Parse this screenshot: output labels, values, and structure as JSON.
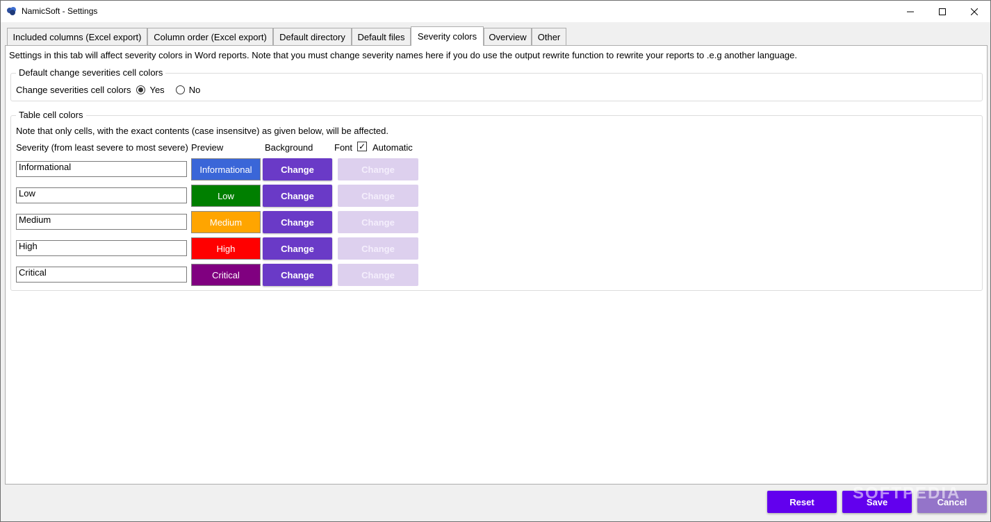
{
  "window": {
    "title": "NamicSoft - Settings",
    "app_icon": "namicsoft-logo-icon"
  },
  "tabs": [
    {
      "label": "Included columns (Excel export)",
      "active": false
    },
    {
      "label": "Column order (Excel export)",
      "active": false
    },
    {
      "label": "Default directory",
      "active": false
    },
    {
      "label": "Default files",
      "active": false
    },
    {
      "label": "Severity colors",
      "active": true
    },
    {
      "label": "Overview",
      "active": false
    },
    {
      "label": "Other",
      "active": false
    }
  ],
  "intro_text": "Settings in this tab will affect severity colors in Word reports. Note that you must change severity names here if you do use the output rewrite function to rewrite your reports to .e.g another language.",
  "default_group": {
    "legend": "Default change severities cell colors",
    "label": "Change severities cell colors",
    "options": [
      {
        "label": "Yes",
        "selected": true
      },
      {
        "label": "No",
        "selected": false
      }
    ]
  },
  "table_group": {
    "legend": "Table cell colors",
    "note": "Note that only cells, with the exact contents (case insensitve) as given below, will be affected.",
    "headers": {
      "severity": "Severity (from least severe to most severe)",
      "preview": "Preview",
      "background": "Background",
      "font": "Font",
      "automatic": "Automatic"
    },
    "automatic_checked": true,
    "rows": [
      {
        "name": "Informational",
        "preview": "Informational",
        "bg_color": "#3a66d8",
        "bg_button": "Change",
        "font_button": "Change"
      },
      {
        "name": "Low",
        "preview": "Low",
        "bg_color": "#007f00",
        "bg_button": "Change",
        "font_button": "Change"
      },
      {
        "name": "Medium",
        "preview": "Medium",
        "bg_color": "#ffa500",
        "bg_button": "Change",
        "font_button": "Change"
      },
      {
        "name": "High",
        "preview": "High",
        "bg_color": "#ff0000",
        "bg_button": "Change",
        "font_button": "Change"
      },
      {
        "name": "Critical",
        "preview": "Critical",
        "bg_color": "#800080",
        "bg_button": "Change",
        "font_button": "Change"
      }
    ]
  },
  "footer": {
    "reset": "Reset",
    "save": "Save",
    "cancel": "Cancel"
  },
  "watermark": "SOFTPEDIA"
}
